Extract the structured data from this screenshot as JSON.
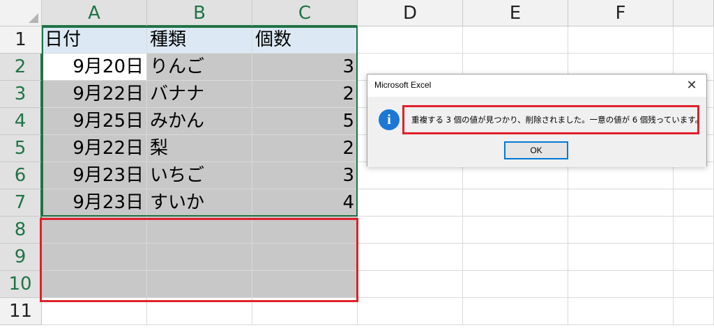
{
  "columns": [
    "A",
    "B",
    "C",
    "D",
    "E",
    "F"
  ],
  "rows": [
    "1",
    "2",
    "3",
    "4",
    "5",
    "6",
    "7",
    "8",
    "9",
    "10",
    "11"
  ],
  "table": {
    "headers": [
      "日付",
      "種類",
      "個数"
    ],
    "data": [
      [
        "9月20日",
        "りんご",
        "3"
      ],
      [
        "9月22日",
        "バナナ",
        "2"
      ],
      [
        "9月25日",
        "みかん",
        "5"
      ],
      [
        "9月22日",
        "梨",
        "2"
      ],
      [
        "9月23日",
        "いちご",
        "3"
      ],
      [
        "9月23日",
        "すいか",
        "4"
      ]
    ]
  },
  "dialog": {
    "title": "Microsoft Excel",
    "close_icon": "close-icon",
    "info_icon_glyph": "i",
    "message": "重複する 3 個の値が見つかり、削除されました。一意の値が 6 個残っています。",
    "ok_label": "OK"
  },
  "colors": {
    "excel_green": "#217346",
    "highlight_red": "#e0202a",
    "header_fill": "#dce9f5",
    "selection_gray": "#c8c8c8",
    "info_blue": "#1c78d4"
  }
}
